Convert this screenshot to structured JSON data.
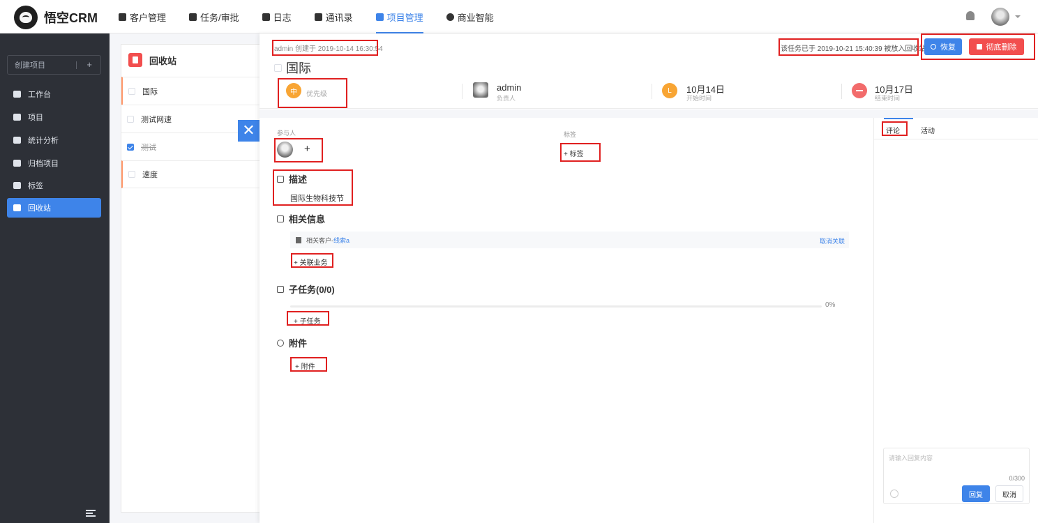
{
  "app": {
    "logo_text": "悟空CRM"
  },
  "nav": {
    "items": [
      {
        "label": "客户管理"
      },
      {
        "label": "任务/审批"
      },
      {
        "label": "日志"
      },
      {
        "label": "通讯录"
      },
      {
        "label": "项目管理"
      },
      {
        "label": "商业智能"
      }
    ],
    "active_index": 4
  },
  "sidebar": {
    "create_label": "创建项目",
    "create_plus": "+",
    "items": [
      {
        "label": "工作台",
        "icon": "monitor-icon"
      },
      {
        "label": "项目",
        "icon": "board-icon"
      },
      {
        "label": "统计分析",
        "icon": "bar-chart-icon"
      },
      {
        "label": "归档项目",
        "icon": "archive-icon"
      },
      {
        "label": "标签",
        "icon": "tag-icon"
      },
      {
        "label": "回收站",
        "icon": "trash-icon"
      }
    ],
    "active_index": 5
  },
  "recycle": {
    "title": "回收站",
    "tasks": [
      {
        "name": "国际",
        "checked": false,
        "flag": true
      },
      {
        "name": "测试网速",
        "checked": false,
        "flag": false
      },
      {
        "name": "测试",
        "checked": true,
        "flag": false
      },
      {
        "name": "速度",
        "checked": false,
        "flag": true
      }
    ]
  },
  "close_symbol": "✕",
  "detail": {
    "creator_line": "admin 创建于 2019-10-14 16:30:54",
    "title": "国际",
    "recycle_note": "该任务已于 2019-10-21 15:40:39 被放入回收站",
    "restore_label": "恢复",
    "delete_label": "彻底删除",
    "meta": {
      "priority_badge": "中",
      "priority_label": "优先级",
      "owner_name": "admin",
      "owner_label": "负责人",
      "start_badge": "L",
      "start_date": "10月14日",
      "start_label": "开始时间",
      "end_date": "10月17日",
      "end_label": "结束时间"
    },
    "participants_label": "参与人",
    "add_symbol": "+",
    "tags_label": "标签",
    "add_tag_label": "+ 标签",
    "description_title": "描述",
    "description_text": "国际生物科技节",
    "related_title": "相关信息",
    "related_item_prefix": "相关客户-",
    "related_item_link": "线索a",
    "related_cancel": "取消关联",
    "add_related_label": "+ 关联业务",
    "subtasks_title": "子任务(0/0)",
    "subtasks_progress": "0%",
    "add_subtask_label": "+ 子任务",
    "attachments_title": "附件",
    "add_attachment_label": "+ 附件"
  },
  "comments": {
    "tabs": [
      "评论",
      "活动"
    ],
    "active_tab": 0,
    "placeholder": "请输入回复内容",
    "count": "0/300",
    "reply_label": "回复",
    "cancel_label": "取消"
  },
  "colors": {
    "primary": "#3e84e9",
    "danger": "#f24e4e",
    "priority": "#f8a534",
    "sidebar_bg": "#2d3037",
    "highlight": "#e02020"
  }
}
